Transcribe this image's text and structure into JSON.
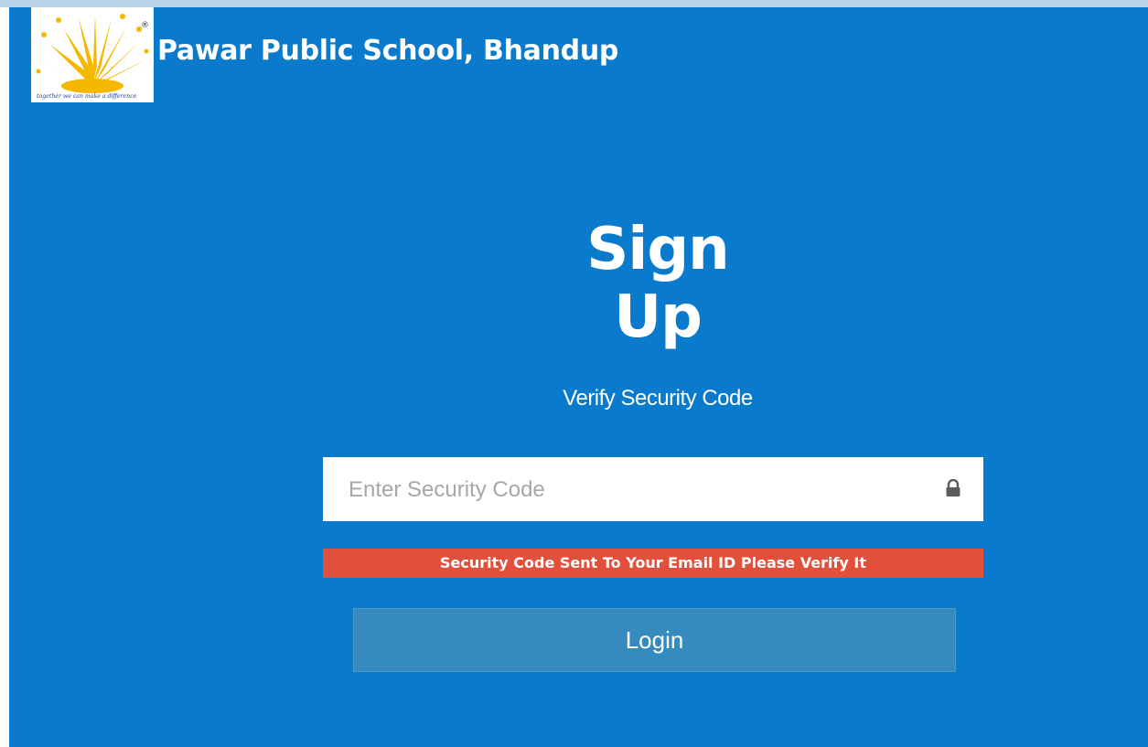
{
  "header": {
    "school_name": "Pawar Public School, Bhandup",
    "logo_icon": "sunburst-logo",
    "logo_tagline": "together we can make a difference"
  },
  "main": {
    "title": "Sign Up",
    "subtitle": "Verify Security Code",
    "security_code_input": {
      "value": "",
      "placeholder": "Enter Security Code",
      "icon": "lock-icon"
    },
    "alert_message": "Security Code Sent To Your Email ID Please Verify It",
    "login_label": "Login"
  },
  "colors": {
    "panel_background": "#0a7acd",
    "alert_background": "#e2503c",
    "button_background": "#358bbd",
    "logo_accent": "#f5b800"
  }
}
